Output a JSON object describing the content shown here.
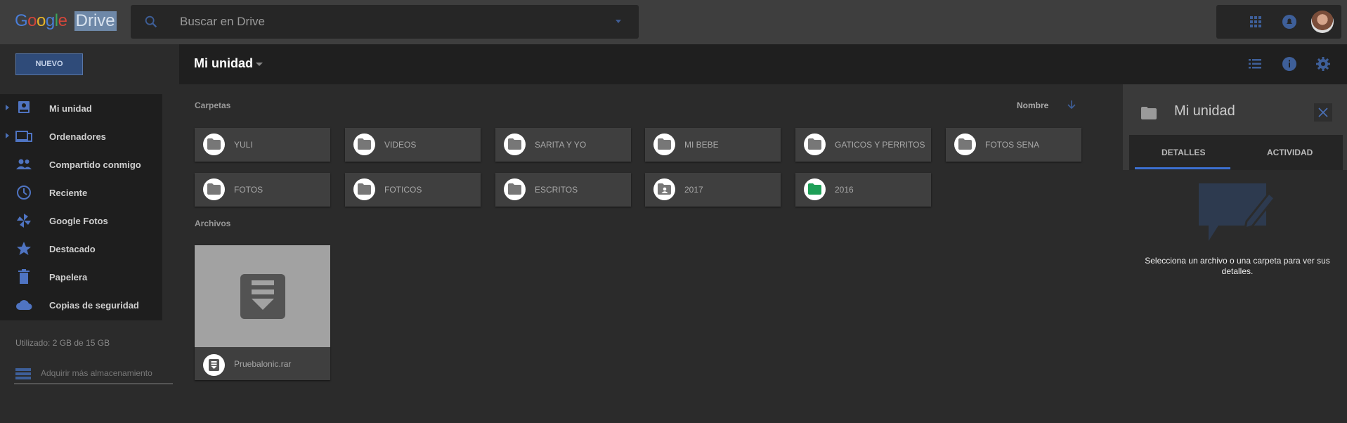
{
  "app": {
    "logo_google": "Google",
    "logo_drive": "Drive"
  },
  "search": {
    "placeholder": "Buscar en Drive"
  },
  "actions": {
    "new_label": "NUEVO"
  },
  "toolbar": {
    "title": "Mi unidad"
  },
  "sidebar": {
    "items": [
      {
        "label": "Mi unidad",
        "icon": "drive-icon",
        "expandable": true
      },
      {
        "label": "Ordenadores",
        "icon": "computers-icon",
        "expandable": true
      },
      {
        "label": "Compartido conmigo",
        "icon": "people-icon",
        "expandable": false
      },
      {
        "label": "Reciente",
        "icon": "clock-icon",
        "expandable": false
      },
      {
        "label": "Google Fotos",
        "icon": "pinwheel-icon",
        "expandable": false
      },
      {
        "label": "Destacado",
        "icon": "star-icon",
        "expandable": false
      },
      {
        "label": "Papelera",
        "icon": "trash-icon",
        "expandable": false
      },
      {
        "label": "Copias de seguridad",
        "icon": "cloud-icon",
        "expandable": false
      }
    ],
    "storage_text": "Utilizado: 2 GB de 15 GB",
    "more_storage_label": "Adquirir más almacenamiento"
  },
  "main": {
    "folders_label": "Carpetas",
    "files_label": "Archivos",
    "sort_label": "Nombre",
    "folders": [
      {
        "name": "YULI",
        "icon": "folder-icon"
      },
      {
        "name": "VIDEOS",
        "icon": "folder-icon"
      },
      {
        "name": "SARITA Y YO",
        "icon": "folder-icon"
      },
      {
        "name": "MI BEBE",
        "icon": "folder-icon"
      },
      {
        "name": "GATICOS Y PERRITOS",
        "icon": "folder-icon"
      },
      {
        "name": "FOTOS SENA",
        "icon": "folder-icon"
      },
      {
        "name": "FOTOS",
        "icon": "folder-icon"
      },
      {
        "name": "FOTICOS",
        "icon": "folder-icon"
      },
      {
        "name": "ESCRITOS",
        "icon": "folder-icon"
      },
      {
        "name": "2017",
        "icon": "shared-folder-icon"
      },
      {
        "name": "2016",
        "icon": "folder-green-icon"
      }
    ],
    "files": [
      {
        "name": "Pruebalonic.rar",
        "icon": "archive-icon"
      }
    ]
  },
  "details": {
    "title": "Mi unidad",
    "tabs": [
      "DETALLES",
      "ACTIVIDAD"
    ],
    "message": "Selecciona un archivo o una carpeta para ver sus detalles."
  },
  "colors": {
    "accent": "#3c70d1",
    "icon_blue": "#3e5f99",
    "green_folder": "#1e9f57"
  }
}
